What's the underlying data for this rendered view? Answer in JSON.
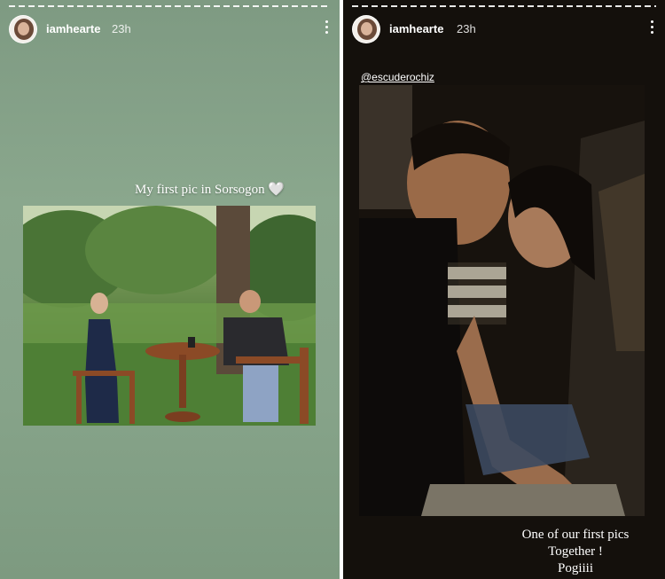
{
  "stories": [
    {
      "username": "iamhearte",
      "timestamp": "23h",
      "caption": "My first pic in Sorsogon 🤍",
      "background_color": "#86a389"
    },
    {
      "username": "iamhearte",
      "timestamp": "23h",
      "mention": "@escuderochiz",
      "caption_lines": [
        "One of our first pics",
        "Together !",
        "Pogiiii"
      ],
      "background_color": "#14100c"
    }
  ],
  "icons": {
    "menu": "more-vertical-icon",
    "avatar": "profile-avatar"
  }
}
